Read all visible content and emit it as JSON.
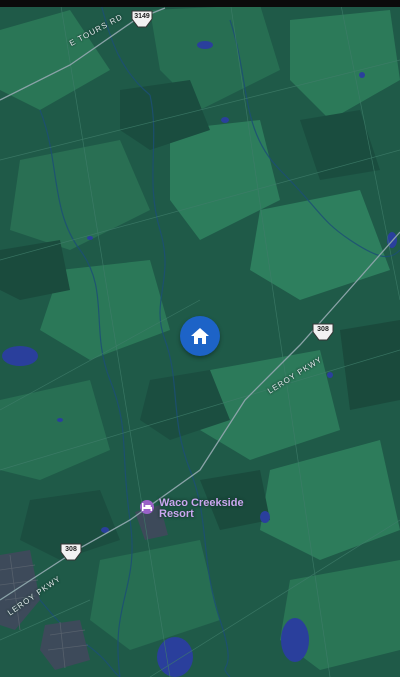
{
  "map": {
    "roads": {
      "e_tours_rd": "E TOURS RD",
      "leroy_pkwy_right": "LEROY PKWY",
      "leroy_pkwy_left": "LEROY PKWY"
    },
    "shields": {
      "top": "3149",
      "right": "308",
      "left": "308"
    },
    "poi": {
      "name": "Waco Creekside Resort",
      "icon": "lodging-bed-icon",
      "color": "#9a62c8"
    },
    "home_marker": {
      "icon": "home-icon",
      "color": "#1d63c7"
    },
    "colors": {
      "land": "#1f5a48",
      "field_light": "#2b7a5a",
      "field_dark": "#184a3d",
      "water": "#2a3f9c",
      "road": "#8aa3a8"
    }
  }
}
